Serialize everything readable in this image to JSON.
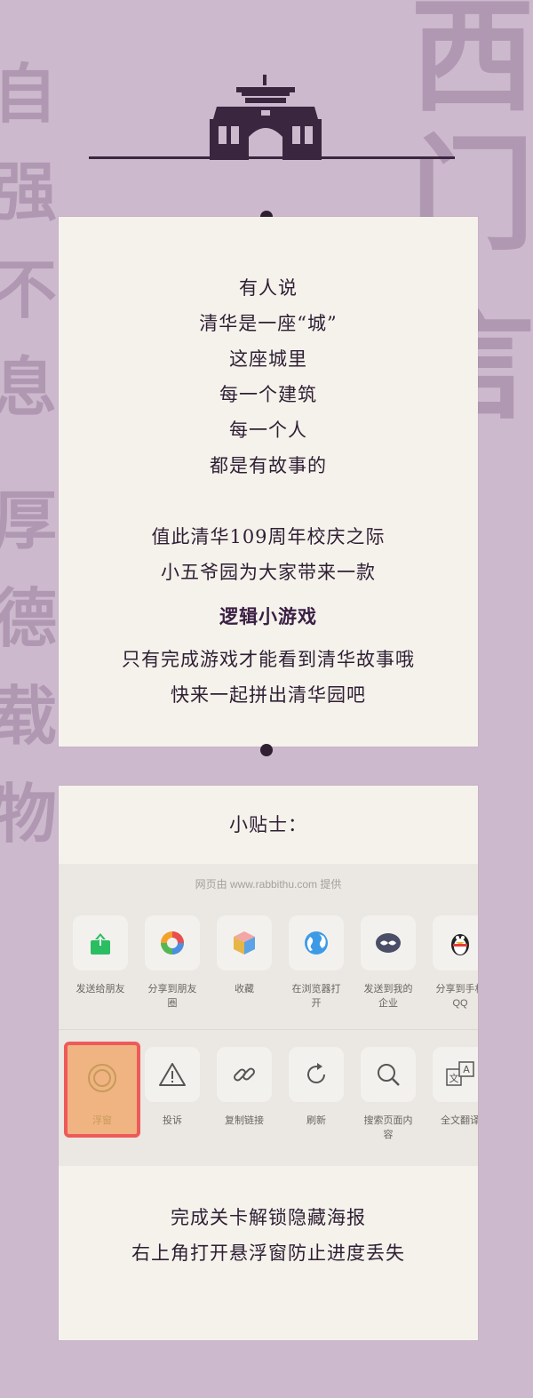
{
  "background_text": {
    "left_column": [
      "自",
      "强",
      "不",
      "息",
      "厚",
      "德",
      "载",
      "物"
    ],
    "right_column": [
      "西",
      "门",
      "言"
    ]
  },
  "intro": {
    "lines": [
      "有人说",
      "清华是一座“城”",
      "这座城里",
      "每一个建筑",
      "每一个人",
      "都是有故事的"
    ],
    "para2": [
      "值此清华109周年校庆之际",
      "小五爷园为大家带来一款"
    ],
    "highlight": "逻辑小游戏",
    "para3": [
      "只有完成游戏才能看到清华故事哦",
      "快来一起拼出清华园吧"
    ]
  },
  "tips": {
    "title": "小贴士：",
    "menu_caption": "网页由 www.rabbithu.com 提供",
    "row1": [
      {
        "label": "发送给朋友",
        "icon": "share-green-icon"
      },
      {
        "label": "分享到朋友\n圈",
        "icon": "moments-icon"
      },
      {
        "label": "收藏",
        "icon": "favorite-cube-icon"
      },
      {
        "label": "在浏览器打\n开",
        "icon": "browser-globe-icon"
      },
      {
        "label": "发送到我的\n企业",
        "icon": "work-chat-icon"
      },
      {
        "label": "分享到手机\nQQ",
        "icon": "qq-penguin-icon"
      }
    ],
    "row2": [
      {
        "label": "浮窗",
        "icon": "float-window-icon"
      },
      {
        "label": "投诉",
        "icon": "warning-icon"
      },
      {
        "label": "复制链接",
        "icon": "link-icon"
      },
      {
        "label": "刷新",
        "icon": "refresh-icon"
      },
      {
        "label": "搜索页面内\n容",
        "icon": "search-icon"
      },
      {
        "label": "全文翻译",
        "icon": "translate-icon"
      }
    ],
    "footer": [
      "完成关卡解锁隐藏海报",
      "右上角打开悬浮窗防止进度丢失"
    ]
  },
  "colors": {
    "background": "#cdb9cd",
    "card": "#f5f2ec",
    "text": "#2e1f33",
    "highlight_border": "#ee5a5a",
    "highlight_fill": "#efb482"
  }
}
